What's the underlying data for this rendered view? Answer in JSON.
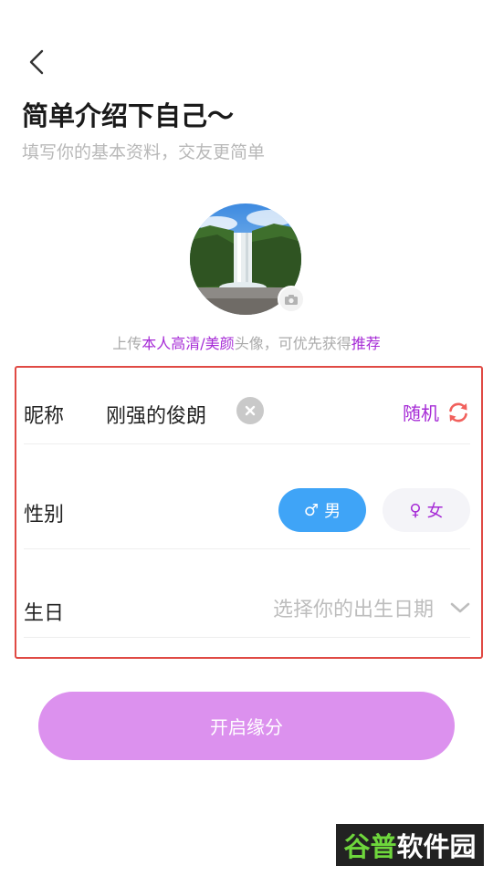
{
  "header": {
    "title": "简单介绍下自己～",
    "subtitle": "填写你的基本资料，交友更简单"
  },
  "upload_hint": {
    "p1": "上传",
    "h1": "本人高清/美颜",
    "p2": "头像，可优先获得",
    "h2": "推荐"
  },
  "form": {
    "nickname": {
      "label": "昵称",
      "value": "刚强的俊朗",
      "random_label": "随机"
    },
    "gender": {
      "label": "性别",
      "male": {
        "symbol": "♂",
        "label": "男",
        "selected": true
      },
      "female": {
        "symbol": "♀",
        "label": "女",
        "selected": false
      }
    },
    "birthday": {
      "label": "生日",
      "placeholder": "选择你的出生日期"
    }
  },
  "submit": {
    "label": "开启缘分"
  },
  "watermark": {
    "part1": "谷普",
    "part2": "软件园"
  },
  "colors": {
    "accent_purple": "#a62bd6",
    "male_blue": "#3fa4f7",
    "submit_bg": "#dc91ee",
    "refresh_red": "#f1605c",
    "highlight_border": "#e04a44"
  },
  "icons": {
    "back": "chevron-left-icon",
    "camera": "camera-icon",
    "clear": "clear-icon",
    "refresh": "refresh-icon",
    "dropdown": "chevron-down-icon"
  }
}
